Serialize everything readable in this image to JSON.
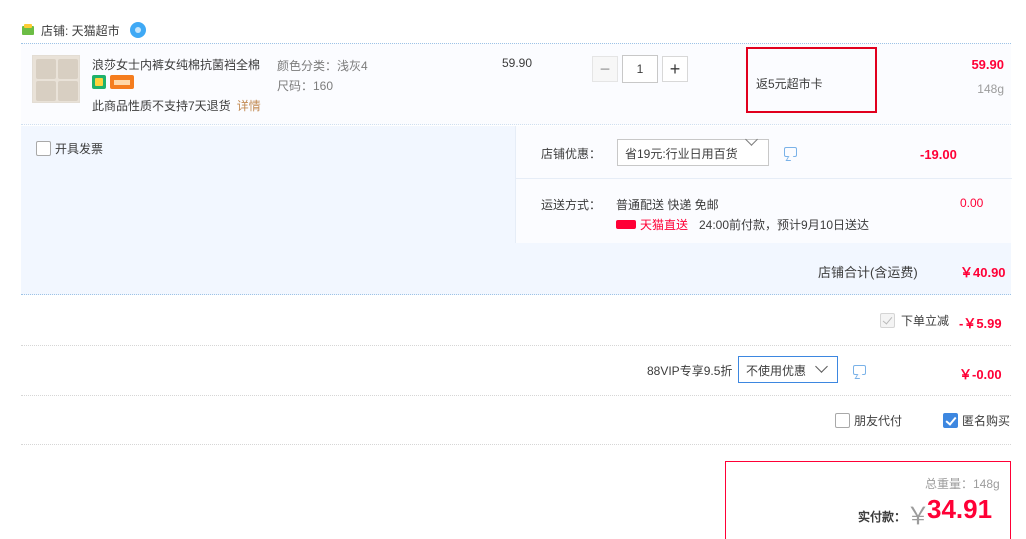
{
  "shop": {
    "label": "店铺: 天猫超市"
  },
  "item": {
    "title": "浪莎女士内裤女纯棉抗菌裆全棉",
    "no_return": "此商品性质不支持7天退货",
    "detail_link": "详情",
    "sku_color": "颜色分类：浅灰4",
    "sku_size": "尺码：160",
    "unit_price": "59.90",
    "quantity": "1",
    "minus": "−",
    "plus": "+",
    "rebate": "返5元超市卡",
    "total": "59.90",
    "weight": "148g"
  },
  "invoice": {
    "label": "开具发票"
  },
  "shop_promo": {
    "label": "店铺优惠：",
    "selected": "省19元:行业日用百货",
    "amount": "-19.00"
  },
  "shipping": {
    "label": "运送方式：",
    "method": "普通配送 快递 免邮",
    "tmall_direct": "天猫直送",
    "eta": "24:00前付款，预计9月10日送达",
    "fee": "0.00"
  },
  "shop_total": {
    "label": "店铺合计(含运费)",
    "value": "￥40.90"
  },
  "instant_discount": {
    "label": "下单立减",
    "amount": "-￥5.99"
  },
  "vip": {
    "label": "88VIP专享9.5折",
    "selected": "不使用优惠",
    "amount": "￥-0.00"
  },
  "options": {
    "friend_pay": "朋友代付",
    "anonymous": "匿名购买"
  },
  "summary": {
    "total_weight": "总重量：148g",
    "pay_label": "实付款：",
    "currency": "￥",
    "pay_amount": "34.91"
  },
  "colors": {
    "accent_red": "#ff0036",
    "accent_blue": "#3d87e0"
  }
}
